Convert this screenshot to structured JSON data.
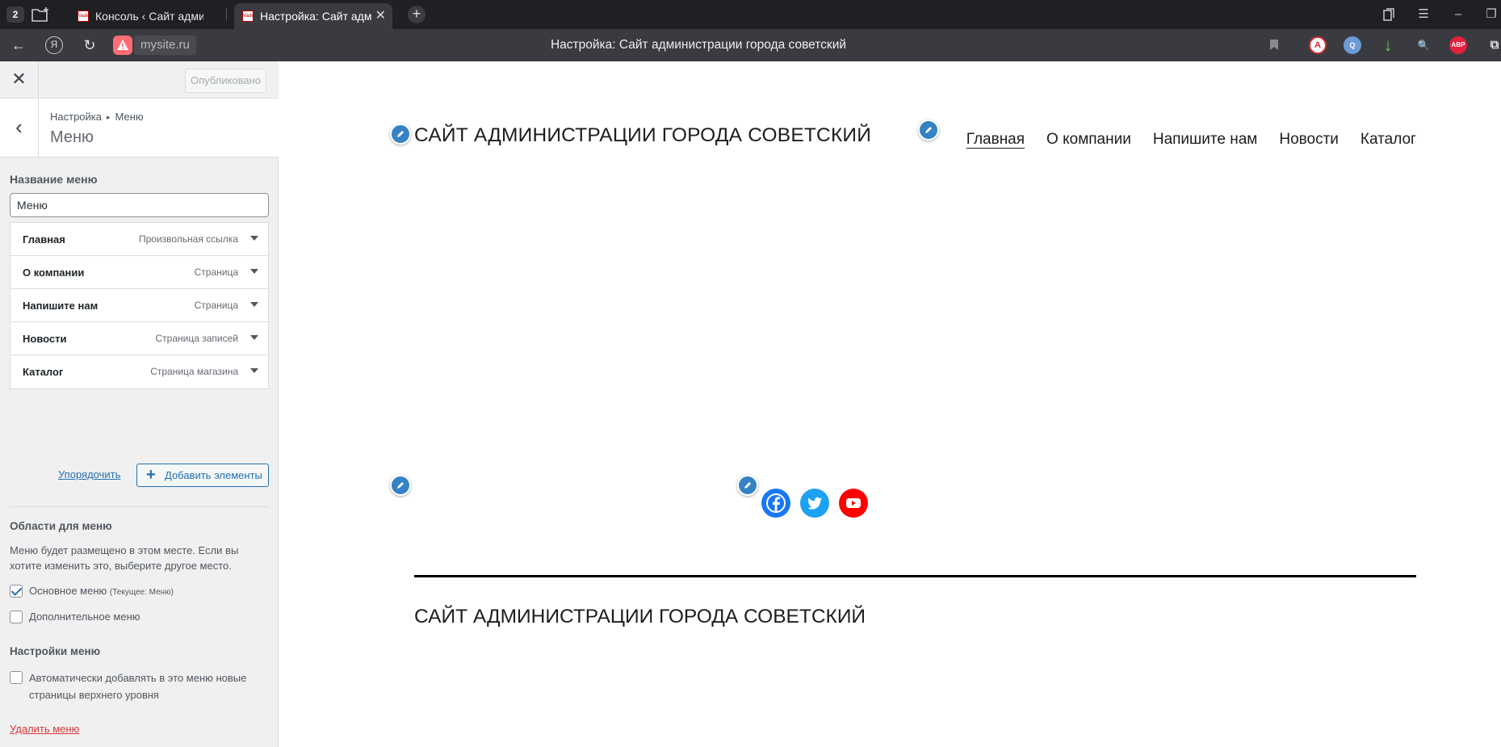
{
  "browser": {
    "tab_count": "2",
    "tabs": [
      {
        "title": "Консоль ‹ Сайт администр",
        "active": false
      },
      {
        "title": "Настройка: Сайт админи",
        "active": true
      }
    ],
    "url": "mysite.ru",
    "page_title": "Настройка: Сайт администрации города советский",
    "extensions": [
      "A",
      "Q",
      "↓",
      "ABP"
    ],
    "colors": {
      "tabbar": "#1f2024",
      "addressbar": "#3a3b40"
    }
  },
  "customizer": {
    "publish_label": "Опубликовано",
    "breadcrumb": {
      "root": "Настройка",
      "current": "Меню"
    },
    "panel_title": "Меню",
    "menu_name_label": "Название меню",
    "menu_name_value": "Меню",
    "menu_items": [
      {
        "title": "Главная",
        "type": "Произвольная ссылка"
      },
      {
        "title": "О компании",
        "type": "Страница"
      },
      {
        "title": "Напишите нам",
        "type": "Страница"
      },
      {
        "title": "Новости",
        "type": "Страница записей"
      },
      {
        "title": "Каталог",
        "type": "Страница магазина"
      }
    ],
    "reorder_label": "Упорядочить",
    "add_items_label": "Добавить элементы",
    "locations_heading": "Области для меню",
    "locations_desc": "Меню будет размещено в этом месте. Если вы хотите изменить это, выберите другое место.",
    "locations": [
      {
        "label": "Основное меню",
        "note": "(Текущее: Меню)",
        "checked": true
      },
      {
        "label": "Дополнительное меню",
        "note": "",
        "checked": false
      }
    ],
    "settings_heading": "Настройки меню",
    "auto_add_label": "Автоматически добавлять в это меню новые страницы верхнего уровня",
    "auto_add_checked": false,
    "delete_label": "Удалить меню",
    "colors": {
      "accent": "#2271b1",
      "danger": "#d63638",
      "sidebar_bg": "#f0f0f1"
    }
  },
  "preview": {
    "site_title": "САЙТ АДМИНИСТРАЦИИ ГОРОДА СОВЕТСКИЙ",
    "nav": [
      "Главная",
      "О компании",
      "Напишите нам",
      "Новости",
      "Каталог"
    ],
    "active_nav": "Главная",
    "social_icons": [
      {
        "name": "facebook-icon",
        "color": "#1877f2"
      },
      {
        "name": "twitter-icon",
        "color": "#1da1f2"
      },
      {
        "name": "youtube-icon",
        "color": "#ff0000"
      }
    ],
    "footer_title": "САЙТ АДМИНИСТРАЦИИ ГОРОДА СОВЕТСКИЙ",
    "colors": {
      "edit_shortcut": "#3582c4"
    }
  }
}
